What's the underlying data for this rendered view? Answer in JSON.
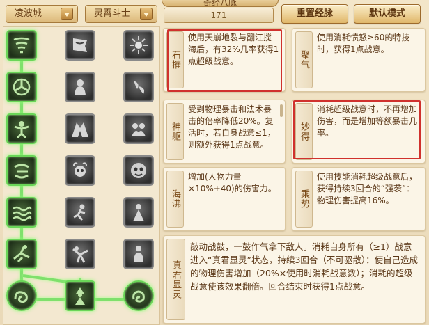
{
  "header": {
    "faction_select": "凌波城",
    "school_select": "灵霄斗士",
    "center_title": "奇经八脉",
    "points": "171",
    "reset_button": "重置经脉",
    "default_button": "默认模式"
  },
  "tree": {
    "rows": [
      {
        "left": "tornado-icon",
        "mid": "banner-icon",
        "right": "sun-burst-icon"
      },
      {
        "left": "spiral-icon",
        "mid": "figure-icon",
        "right": "flame-drops-icon"
      },
      {
        "left": "warrior-icon",
        "mid": "cave-icon",
        "right": "spirits-icon"
      },
      {
        "left": "fist-icon",
        "mid": "skull-icon",
        "right": "demon-face-icon"
      },
      {
        "left": "waves-icon",
        "mid": "runner-icon",
        "right": "robed-figure-icon"
      },
      {
        "left": "fallen-warrior-icon",
        "mid": "fighter-icon",
        "right": "seated-figure-icon"
      }
    ],
    "bottom": {
      "left": "dragon-icon",
      "mid": "sage-icon",
      "right": "beast-icon"
    }
  },
  "cards": [
    {
      "name": "石摧",
      "text": "使用天崩地裂与翻江搅海后，有32%几率获得1点超级战意。"
    },
    {
      "name": "聚气",
      "text": "使用消耗愤怒≥60的特技时，获得1点战意。"
    },
    {
      "name": "神躯",
      "text": "受到物理暴击和法术暴击的倍率降低20%。复活时，若自身战意≤1，则额外获得1点战意。"
    },
    {
      "name": "妙得",
      "text": "消耗超级战意时，不再增加伤害，而是增加等额暴击几率。"
    },
    {
      "name": "海沸",
      "text": "增加(人物力量×10%+40)的伤害力。"
    },
    {
      "name": "乘势",
      "text": "使用技能消耗超级战意后，获得持续3回合的“强袭”：物理伤害提高16%。"
    },
    {
      "name": "真君显灵",
      "text": "敲动战鼓，一鼓作气拿下敌人。消耗自身所有（≥1）战意进入“真君显灵”状态，持续3回合（不可驱散）：使自己造成的物理伤害增加（20%×使用时消耗战意数）；消耗的超级战意使该效果翻倍。回合结束时获得1点战意。"
    }
  ],
  "colors": {
    "highlight": "#d0312d",
    "active_glow": "#7fe06c",
    "text": "#5a3616"
  }
}
